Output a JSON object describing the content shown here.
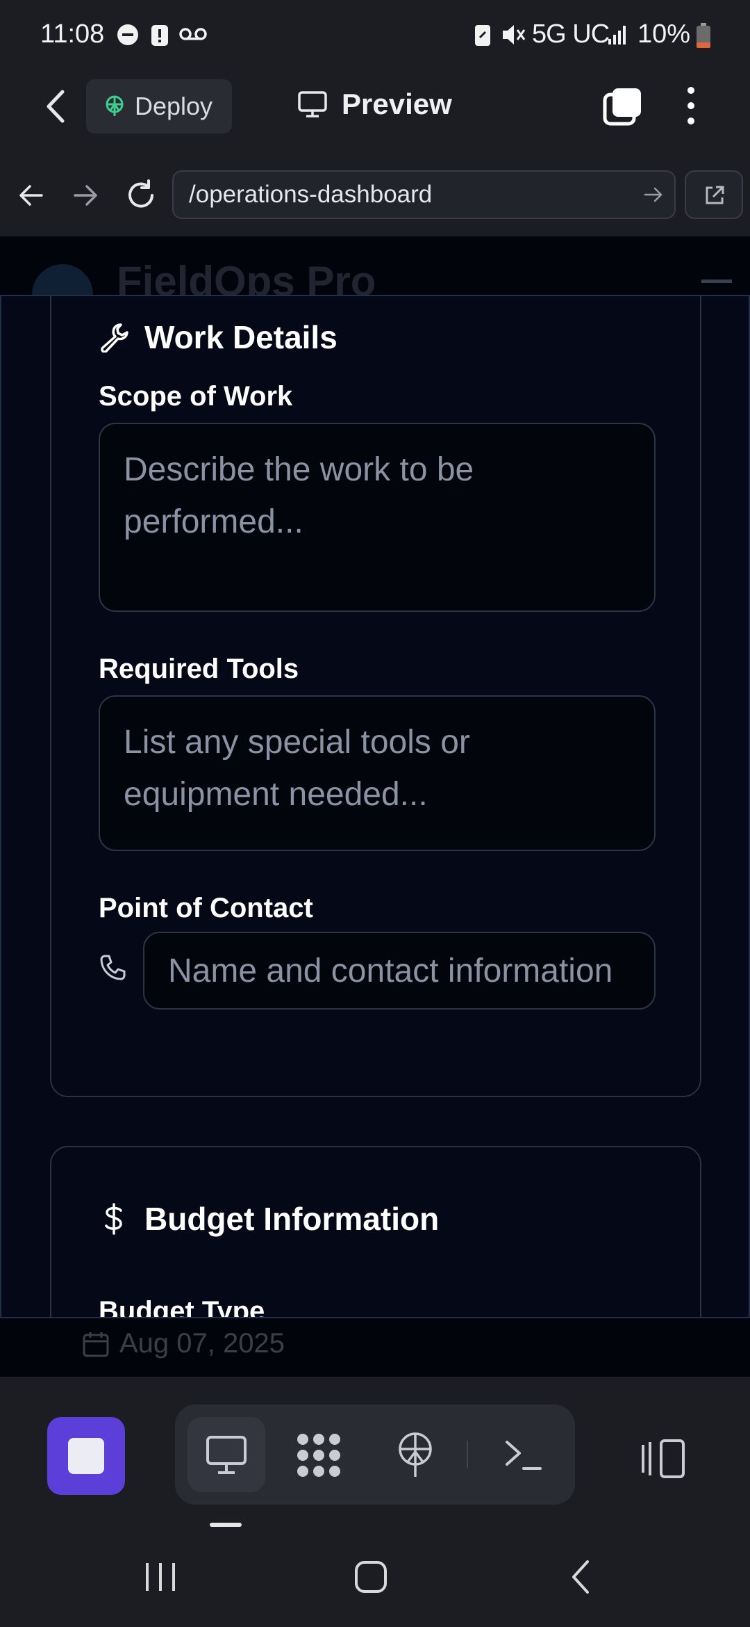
{
  "status_bar": {
    "time": "11:08",
    "network": "5G UC",
    "battery": "10%"
  },
  "app_bar": {
    "deploy_label": "Deploy",
    "preview_label": "Preview"
  },
  "browser": {
    "url": "/operations-dashboard"
  },
  "background_page": {
    "brand": "FieldOps Pro",
    "date": "Aug 07, 2025"
  },
  "work_details": {
    "title": "Work Details",
    "scope_label": "Scope of Work",
    "scope_placeholder": "Describe the work to be performed...",
    "tools_label": "Required Tools",
    "tools_placeholder": "List any special tools or equipment needed...",
    "contact_label": "Point of Contact",
    "contact_placeholder": "Name and contact information"
  },
  "budget": {
    "title": "Budget Information",
    "type_label": "Budget Type"
  },
  "colors": {
    "accent": "#5b3fd8",
    "modal_bg": "#050816",
    "deploy_icon": "#3ecf8e"
  }
}
